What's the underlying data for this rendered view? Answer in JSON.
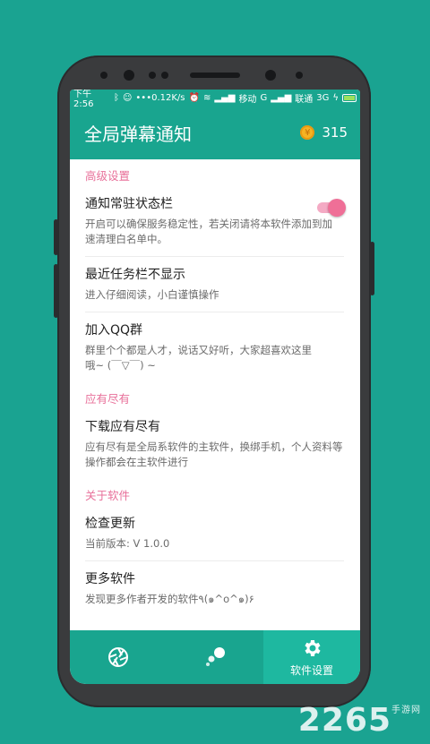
{
  "statusbar": {
    "time": "下午2:56",
    "speed": "0.12K/s",
    "carrier1": "移动",
    "network1": "G",
    "carrier2": "联通",
    "network2": "3G"
  },
  "appbar": {
    "title": "全局弹幕通知",
    "coin_count": "315"
  },
  "sections": [
    {
      "title": "高级设置"
    },
    {
      "title": "应有尽有"
    },
    {
      "title": "关于软件"
    }
  ],
  "items": {
    "notify_resident": {
      "title": "通知常驻状态栏",
      "desc": "开启可以确保服务稳定性，若关闭请将本软件添加到加速清理白名单中。",
      "toggle_on": true
    },
    "hide_recent": {
      "title": "最近任务栏不显示",
      "desc": "进入仔细阅读，小白谨慎操作"
    },
    "join_qq": {
      "title": "加入QQ群",
      "desc": "群里个个都是人才，说话又好听，大家超喜欢这里哦~ (￣▽￣) ~"
    },
    "download": {
      "title": "下载应有尽有",
      "desc": "应有尽有是全局系软件的主软件，换绑手机，个人资料等操作都会在主软件进行"
    },
    "check_update": {
      "title": "检查更新",
      "desc": "当前版本: V 1.0.0"
    },
    "more_apps": {
      "title": "更多软件",
      "desc": "发现更多作者开发的软件٩(๑^o^๑)۶"
    }
  },
  "bottomnav": {
    "settings_label": "软件设置"
  },
  "colors": {
    "primary": "#19a58f",
    "accent": "#ef6f97",
    "section": "#e8709a"
  },
  "watermark": {
    "brand": "2265",
    "sub": "手游网"
  }
}
